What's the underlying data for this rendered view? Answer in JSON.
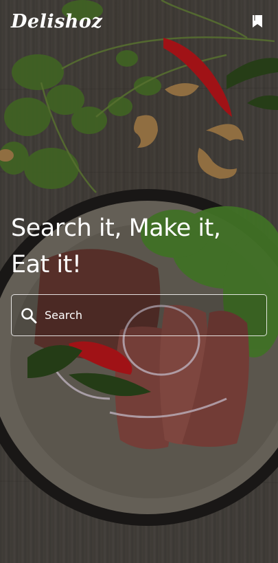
{
  "header": {
    "logo_text": "Delishoz",
    "bookmark_icon": "bookmark-icon"
  },
  "hero": {
    "title_line1": "Search it, Make it,",
    "title_line2": "Eat it!"
  },
  "search": {
    "placeholder": "Search",
    "value": "",
    "icon": "search-icon"
  },
  "colors": {
    "text": "#ffffff",
    "background": "#4b4742",
    "chili": "#c4161c",
    "herb": "#4f7a2a"
  }
}
